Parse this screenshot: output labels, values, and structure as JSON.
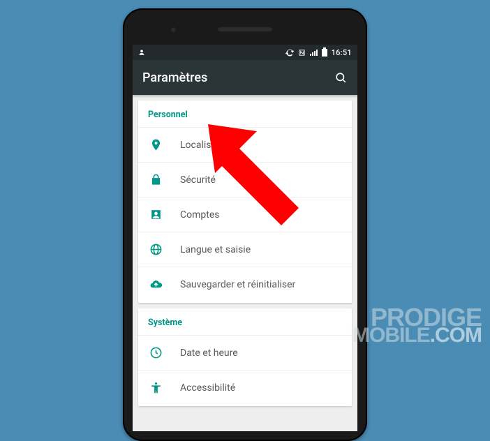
{
  "status_bar": {
    "time": "16:51"
  },
  "app_bar": {
    "title": "Paramètres"
  },
  "sections": [
    {
      "header": "Personnel",
      "items": [
        {
          "icon": "location-icon",
          "label": "Localisation"
        },
        {
          "icon": "lock-icon",
          "label": "Sécurité"
        },
        {
          "icon": "account-icon",
          "label": "Comptes"
        },
        {
          "icon": "language-icon",
          "label": "Langue et saisie"
        },
        {
          "icon": "backup-icon",
          "label": "Sauvegarder et réinitialiser"
        }
      ]
    },
    {
      "header": "Système",
      "items": [
        {
          "icon": "clock-icon",
          "label": "Date et heure"
        },
        {
          "icon": "accessibility-icon",
          "label": "Accessibilité"
        }
      ]
    }
  ],
  "annotation": {
    "type": "arrow",
    "target": "settings-row-securite",
    "color": "#ff0000"
  },
  "watermark": {
    "line1": "PRODIGE",
    "line2_a": "MOBILE",
    "line2_b": ".COM"
  },
  "colors": {
    "accent": "#009688",
    "appbar": "#2b3538",
    "background": "#4b8cb5"
  }
}
